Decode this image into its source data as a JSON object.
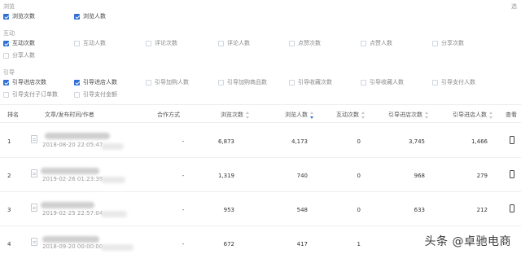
{
  "sections": {
    "browse": {
      "title": "浏览",
      "options": [
        {
          "label": "浏览次数",
          "checked": true
        },
        {
          "label": "浏览人数",
          "checked": true
        }
      ]
    },
    "interact": {
      "title": "互动",
      "options": [
        {
          "label": "互动次数",
          "checked": true
        },
        {
          "label": "互动人数",
          "checked": false
        },
        {
          "label": "评论次数",
          "checked": false
        },
        {
          "label": "评论人数",
          "checked": false
        },
        {
          "label": "点赞次数",
          "checked": false
        },
        {
          "label": "点赞人数",
          "checked": false
        },
        {
          "label": "分享次数",
          "checked": false
        },
        {
          "label": "分享人数",
          "checked": false
        }
      ]
    },
    "guide": {
      "title": "引导",
      "options": [
        {
          "label": "引导进店次数",
          "checked": true
        },
        {
          "label": "引导进店人数",
          "checked": true
        },
        {
          "label": "引导加购人数",
          "checked": false
        },
        {
          "label": "引导加购商品数",
          "checked": false
        },
        {
          "label": "引导收藏次数",
          "checked": false
        },
        {
          "label": "引导收藏人数",
          "checked": false
        },
        {
          "label": "引导支付人数",
          "checked": false
        },
        {
          "label": "引导支付子订单数",
          "checked": false
        },
        {
          "label": "引导支付金额",
          "checked": false
        }
      ]
    },
    "corner_label": "选"
  },
  "table": {
    "headers": {
      "rank": "排名",
      "article": "文章/发布时间/作者",
      "coop": "合作方式",
      "views": "浏览次数",
      "viewers": "浏览人数",
      "interact": "互动次数",
      "guide_visits": "引导进店次数",
      "guide_visitors": "引导进店人数",
      "view": "查看"
    },
    "rows": [
      {
        "rank": "1",
        "date": "2018-08-20 22:05:47",
        "coop": "-",
        "views": "6,873",
        "viewers": "4,173",
        "interact": "0",
        "guide_visits": "3,745",
        "guide_visitors": "1,466"
      },
      {
        "rank": "2",
        "date": "2019-02-26 01:23:39",
        "coop": "-",
        "views": "1,319",
        "viewers": "740",
        "interact": "0",
        "guide_visits": "968",
        "guide_visitors": "279"
      },
      {
        "rank": "3",
        "date": "2019-02-25 22:57:04",
        "coop": "-",
        "views": "953",
        "viewers": "548",
        "interact": "0",
        "guide_visits": "633",
        "guide_visitors": "212"
      },
      {
        "rank": "4",
        "date": "2018-09-20 00:00:00",
        "coop": "-",
        "views": "672",
        "viewers": "417",
        "interact": "1",
        "guide_visits": "",
        "guide_visitors": ""
      }
    ]
  },
  "watermark": "头条 @卓驰电商",
  "colors": {
    "accent": "#2f6fd6",
    "divider": "#eeeeee"
  }
}
